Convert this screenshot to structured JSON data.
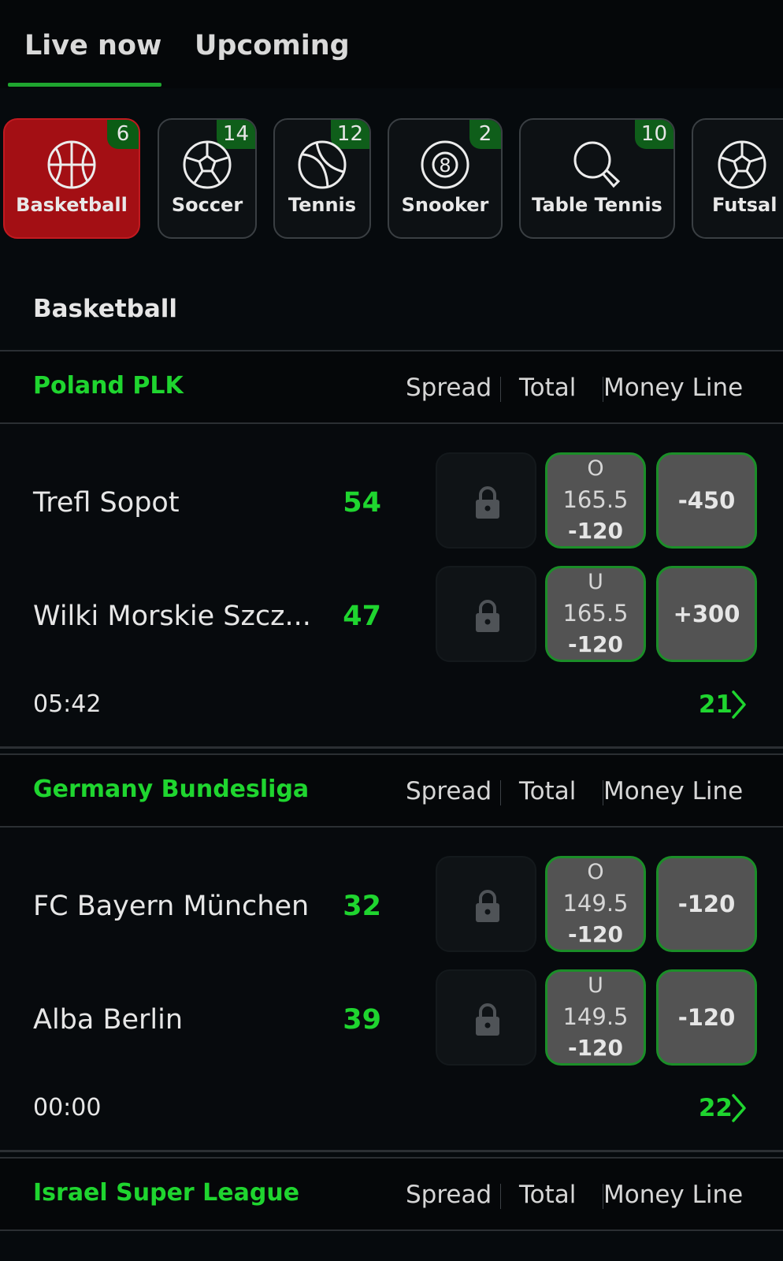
{
  "tabs": {
    "live": "Live now",
    "upcoming": "Upcoming"
  },
  "sports": [
    {
      "label": "Basketball",
      "count": "6",
      "icon": "basketball-icon",
      "active": true
    },
    {
      "label": "Soccer",
      "count": "14",
      "icon": "soccer-ball-icon"
    },
    {
      "label": "Tennis",
      "count": "12",
      "icon": "tennis-ball-icon"
    },
    {
      "label": "Snooker",
      "count": "2",
      "icon": "eight-ball-icon"
    },
    {
      "label": "Table Tennis",
      "count": "10",
      "icon": "table-tennis-paddle-icon"
    },
    {
      "label": "Futsal",
      "count": "",
      "icon": "futsal-ball-icon"
    }
  ],
  "section_title": "Basketball",
  "markets": {
    "spread": "Spread",
    "total": "Total",
    "moneyline": "Money Line"
  },
  "colors": {
    "accent_green": "#1fd52f",
    "active_chip": "#a30f14",
    "odds_bg": "#535353"
  },
  "leagues": [
    {
      "name": "Poland PLK",
      "match": {
        "home": {
          "team": "Trefl Sopot",
          "score": "54",
          "total_side": "O",
          "total_line": "165.5",
          "total_odds": "-120",
          "moneyline": "-450"
        },
        "away": {
          "team": "Wilki Morskie Szcz...",
          "score": "47",
          "total_side": "U",
          "total_line": "165.5",
          "total_odds": "-120",
          "moneyline": "+300"
        },
        "clock": "05:42",
        "more_markets": "21"
      }
    },
    {
      "name": "Germany Bundesliga",
      "match": {
        "home": {
          "team": "FC Bayern München",
          "score": "32",
          "total_side": "O",
          "total_line": "149.5",
          "total_odds": "-120",
          "moneyline": "-120"
        },
        "away": {
          "team": "Alba Berlin",
          "score": "39",
          "total_side": "U",
          "total_line": "149.5",
          "total_odds": "-120",
          "moneyline": "-120"
        },
        "clock": "00:00",
        "more_markets": "22"
      }
    },
    {
      "name": "Israel Super League"
    }
  ]
}
